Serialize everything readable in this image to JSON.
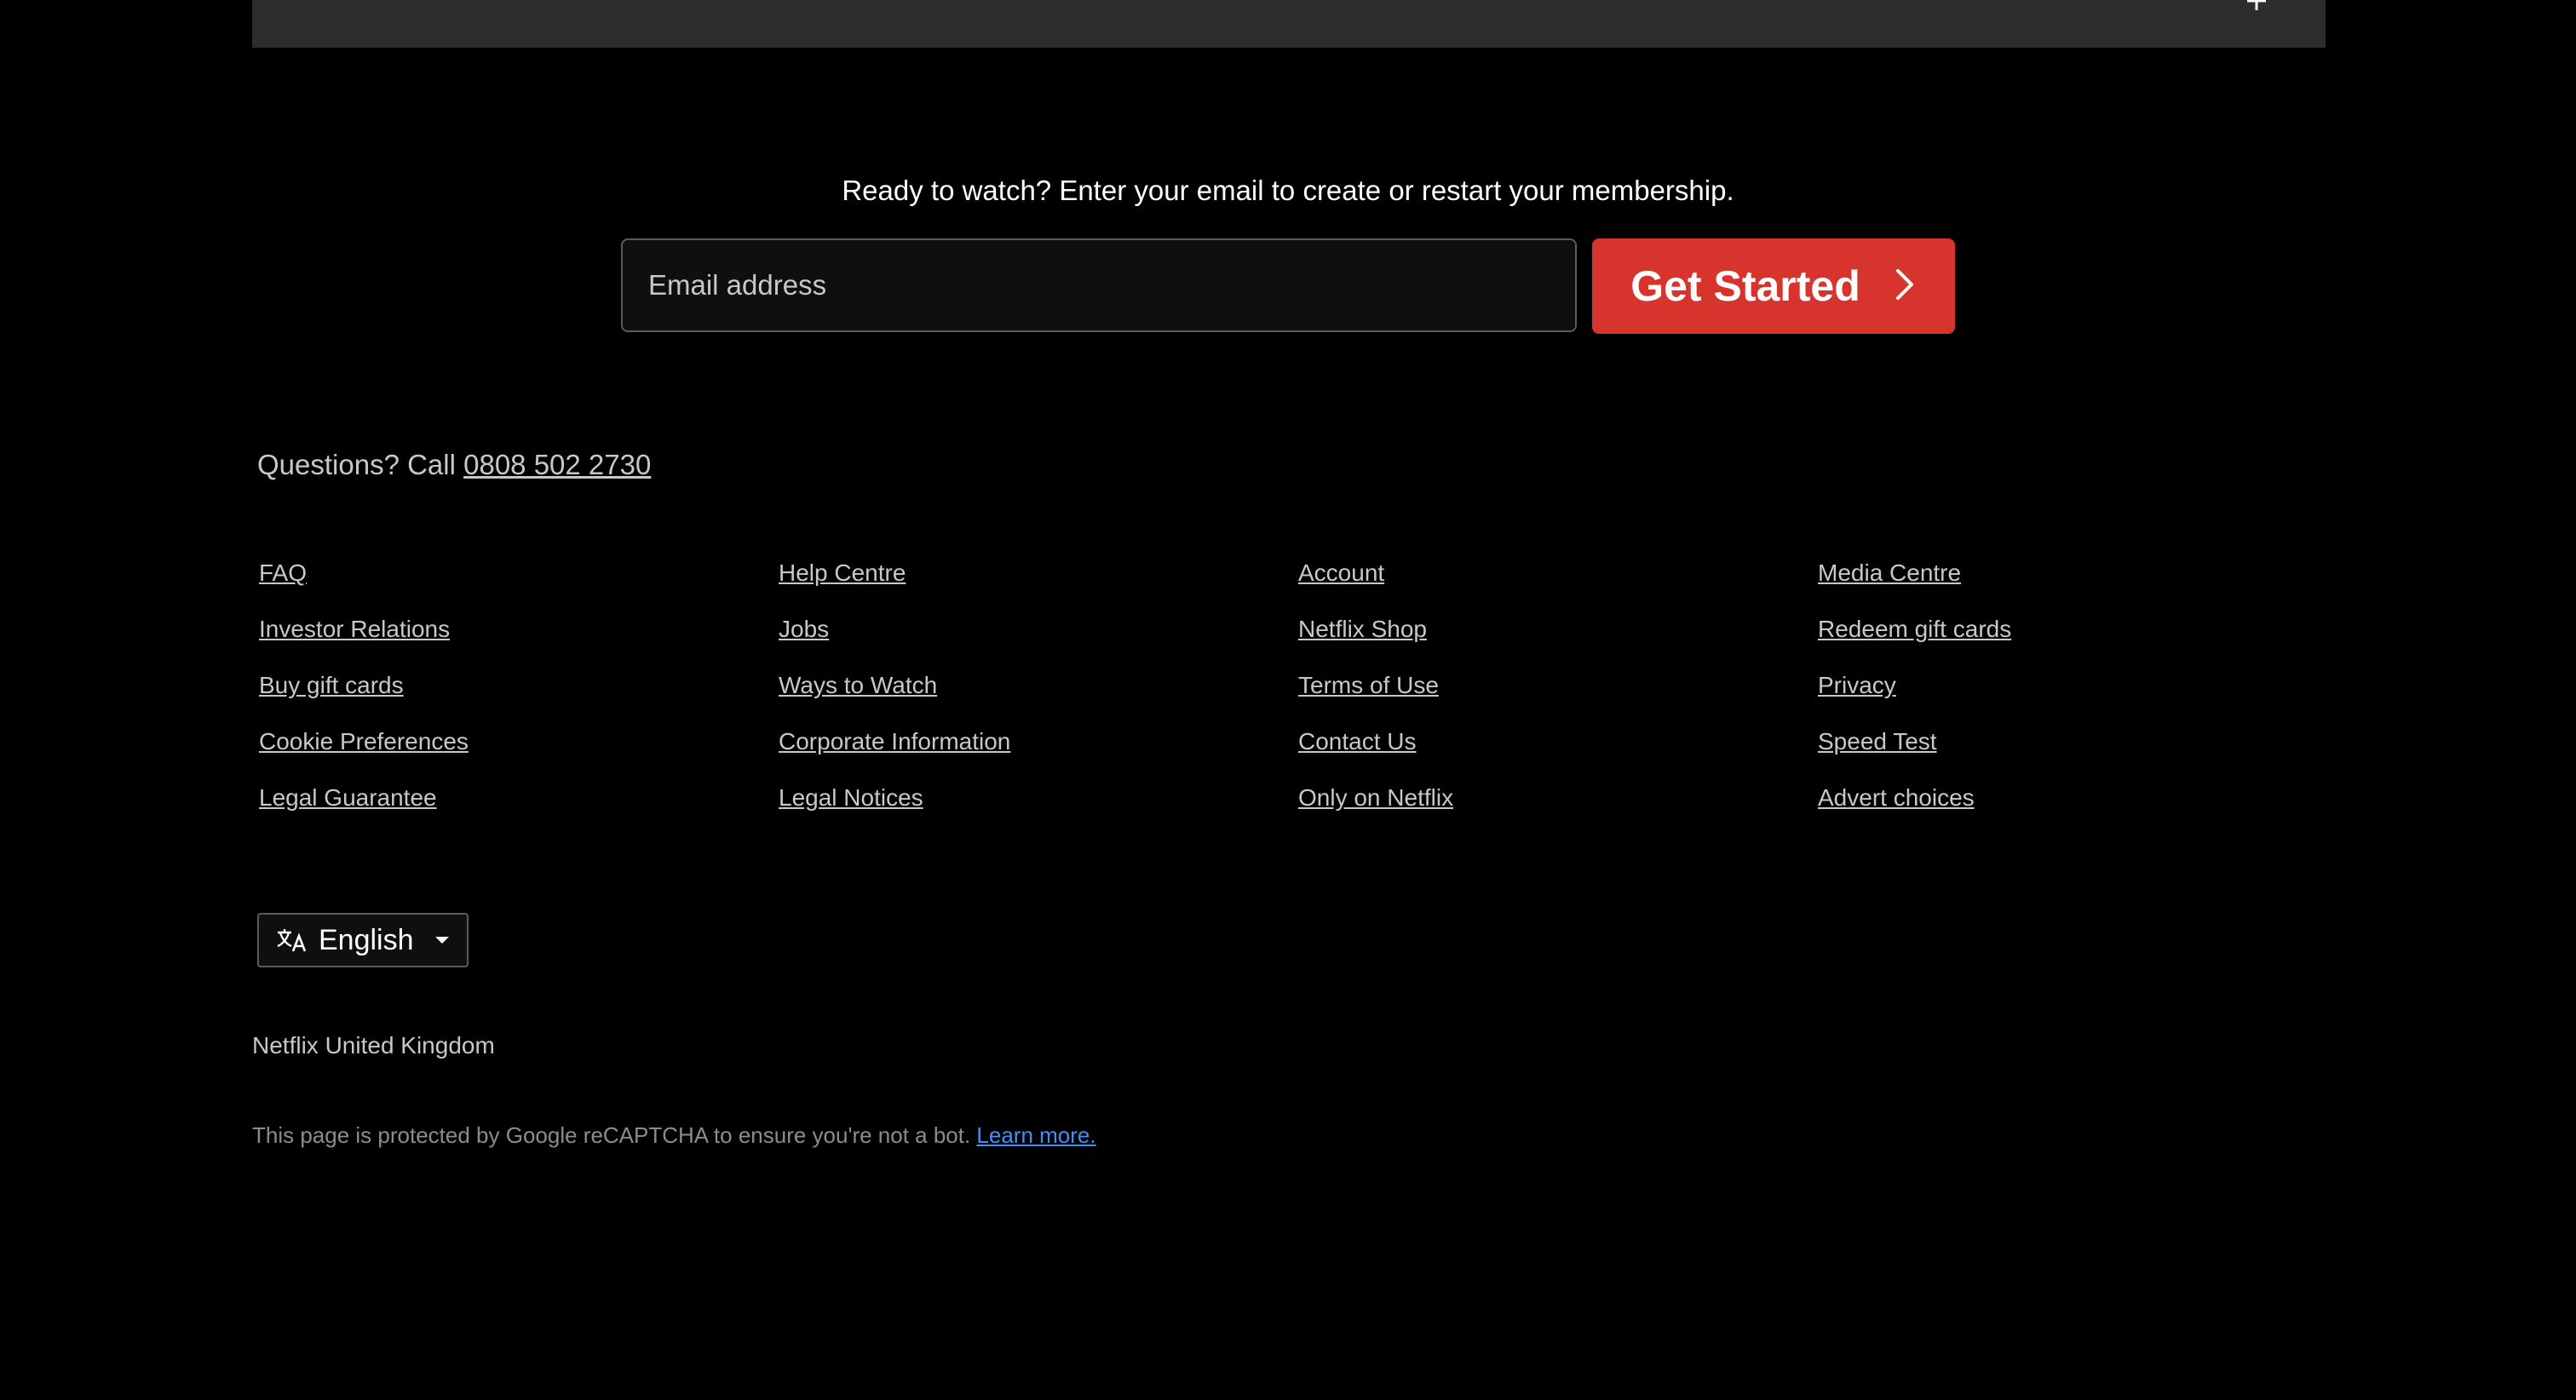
{
  "faq_bar": {
    "icon": "plus-icon"
  },
  "cta": {
    "text": "Ready to watch? Enter your email to create or restart your membership.",
    "email_placeholder": "Email address",
    "email_value": "",
    "button_label": "Get Started",
    "button_icon": "chevron-right-icon",
    "button_color": "#d6342c"
  },
  "questions": {
    "prefix": "Questions? Call ",
    "phone": "0808 502 2730"
  },
  "footer_links": {
    "col1": [
      "FAQ",
      "Investor Relations",
      "Buy gift cards",
      "Cookie Preferences",
      "Legal Guarantee"
    ],
    "col2": [
      "Help Centre",
      "Jobs",
      "Ways to Watch",
      "Corporate Information",
      "Legal Notices"
    ],
    "col3": [
      "Account",
      "Netflix Shop",
      "Terms of Use",
      "Contact Us",
      "Only on Netflix"
    ],
    "col4": [
      "Media Centre",
      "Redeem gift cards",
      "Privacy",
      "Speed Test",
      "Advert choices"
    ]
  },
  "language": {
    "icon": "translate-icon",
    "selected": "English",
    "caret_icon": "caret-down-icon"
  },
  "country": "Netflix United Kingdom",
  "recaptcha": {
    "text": "This page is protected by Google reCAPTCHA to ensure you're not a bot. ",
    "link": "Learn more.",
    "link_color": "#448ef6"
  }
}
